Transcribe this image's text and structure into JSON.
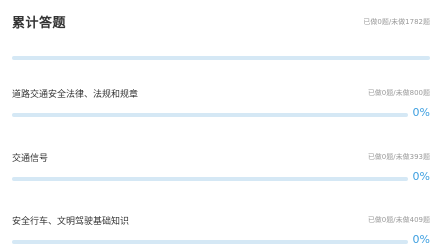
{
  "summary": {
    "title": "累计答题",
    "stat": "已做0题/未做1782题"
  },
  "sections": [
    {
      "title": "道路交通安全法律、法规和规章",
      "stat": "已做0题/未做800题",
      "percent_label": "0%",
      "progress": 0
    },
    {
      "title": "交通信号",
      "stat": "已做0题/未做393题",
      "percent_label": "0%",
      "progress": 0
    },
    {
      "title": "安全行车、文明驾驶基础知识",
      "stat": "已做0题/未做409题",
      "percent_label": "0%",
      "progress": 0
    }
  ],
  "colors": {
    "accent": "#3d9fe0",
    "track": "#d5e8f5",
    "title": "#333333",
    "muted": "#9a9a9a"
  }
}
